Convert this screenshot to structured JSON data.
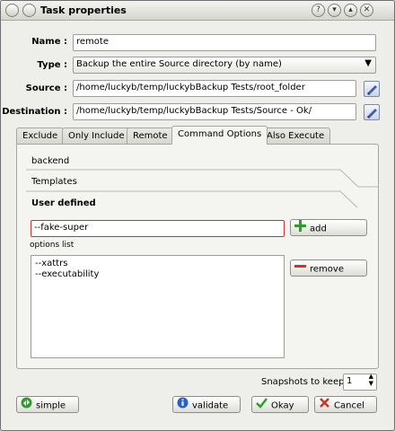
{
  "window": {
    "title": "Task properties",
    "help_glyph": "?",
    "min_glyph": "▾",
    "max_glyph": "▴",
    "close_glyph": "✕"
  },
  "form": {
    "name_label": "Name :",
    "name_value": "remote",
    "type_label": "Type :",
    "type_value": "Backup the entire Source directory (by name)",
    "source_label": "Source :",
    "source_value": "/home/luckyb/temp/luckybBackup Tests/root_folder",
    "destination_label": "Destination :",
    "destination_value": "/home/luckyb/temp/luckybBackup Tests/Source - Ok/"
  },
  "tabs": [
    "Exclude",
    "Only Include",
    "Remote",
    "Command Options",
    "Also Execute"
  ],
  "command_options": {
    "sections": [
      "backend",
      "Templates",
      "User defined"
    ],
    "option_input_value": "--fake-super",
    "add_label": "add",
    "options_list_label": "options list",
    "options": [
      "--xattrs",
      "--executability"
    ],
    "remove_label": "remove"
  },
  "snapshots": {
    "label": "Snapshots to keep:",
    "value": "1"
  },
  "buttons": {
    "simple": "simple",
    "validate": "validate",
    "okay": "Okay",
    "cancel": "Cancel"
  },
  "colors": {
    "accent_red": "#c0392b",
    "add_green": "#2e9d2e",
    "info_blue": "#2a5fc8"
  }
}
